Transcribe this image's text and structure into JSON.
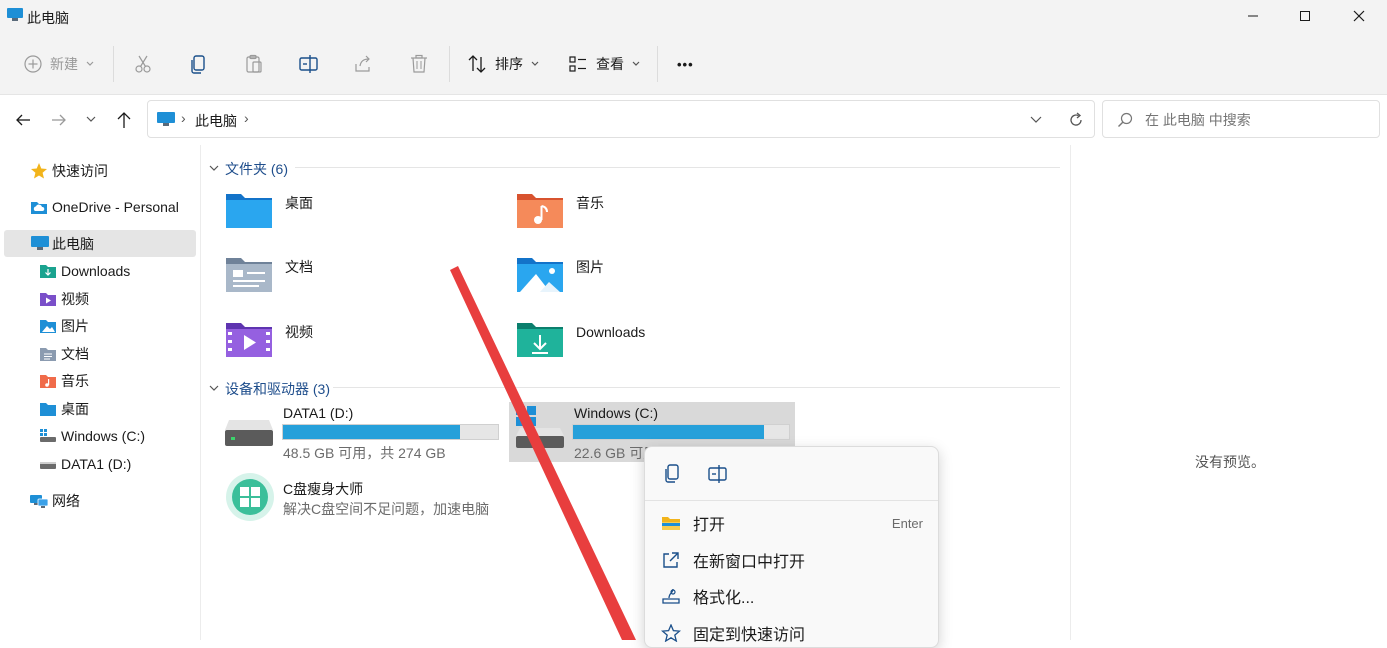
{
  "window": {
    "title": "此电脑"
  },
  "toolbar": {
    "new_label": "新建",
    "sort_label": "排序",
    "view_label": "查看",
    "more_label": "•••"
  },
  "address": {
    "crumb": "此电脑",
    "separator": "›",
    "search_placeholder": "在 此电脑 中搜索"
  },
  "sidebar": {
    "quick_access": "快速访问",
    "onedrive": "OneDrive - Personal",
    "this_pc": "此电脑",
    "items": [
      "Downloads",
      "视频",
      "图片",
      "文档",
      "音乐",
      "桌面",
      "Windows (C:)",
      "DATA1 (D:)"
    ],
    "network": "网络"
  },
  "folders_group": {
    "header": "文件夹 (6)"
  },
  "folders": [
    "桌面",
    "音乐",
    "文档",
    "图片",
    "视频",
    "Downloads"
  ],
  "devices_group": {
    "header": "设备和驱动器 (3)"
  },
  "drives": [
    {
      "name": "DATA1 (D:)",
      "usage": "48.5 GB 可用，共 274 GB",
      "used_fraction": 0.823
    },
    {
      "name": "Windows (C:)",
      "usage": "22.6 GB 可用",
      "used_fraction": 0.886
    }
  ],
  "app": {
    "name": "C盘瘦身大师",
    "desc": "解决C盘空间不足问题，加速电脑"
  },
  "preview": {
    "text": "没有预览。"
  },
  "context_menu": {
    "open": "打开",
    "open_key": "Enter",
    "open_new_window": "在新窗口中打开",
    "format": "格式化...",
    "pin_quick": "固定到快速访问"
  },
  "colors": {
    "accent": "#26a0da",
    "group_header": "#1f4e8c",
    "annotation_arrow": "#e83e3e"
  }
}
